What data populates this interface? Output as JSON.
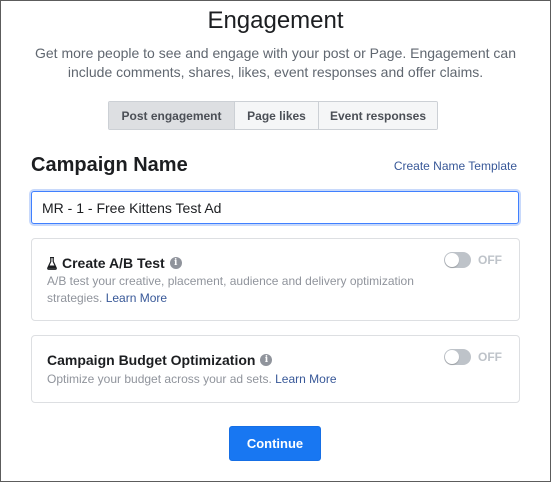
{
  "header": {
    "title": "Engagement",
    "subtitle": "Get more people to see and engage with your post or Page. Engagement can include comments, shares, likes, event responses and offer claims."
  },
  "tabs": [
    {
      "label": "Post engagement",
      "active": true
    },
    {
      "label": "Page likes",
      "active": false
    },
    {
      "label": "Event responses",
      "active": false
    }
  ],
  "campaign": {
    "heading": "Campaign Name",
    "template_link": "Create Name Template",
    "name_value": "MR - 1 - Free Kittens Test Ad"
  },
  "ab_test": {
    "title": "Create A/B Test",
    "icon": "flask-icon",
    "desc": "A/B test your creative, placement, audience and delivery optimization strategies.",
    "learn_more": "Learn More",
    "toggle_label": "OFF"
  },
  "cbo": {
    "title": "Campaign Budget Optimization",
    "desc": "Optimize your budget across your ad sets.",
    "learn_more": "Learn More",
    "toggle_label": "OFF"
  },
  "footer": {
    "continue_label": "Continue"
  },
  "colors": {
    "accent": "#1877f2",
    "link": "#385898",
    "toggle_off": "#bec3c9"
  }
}
